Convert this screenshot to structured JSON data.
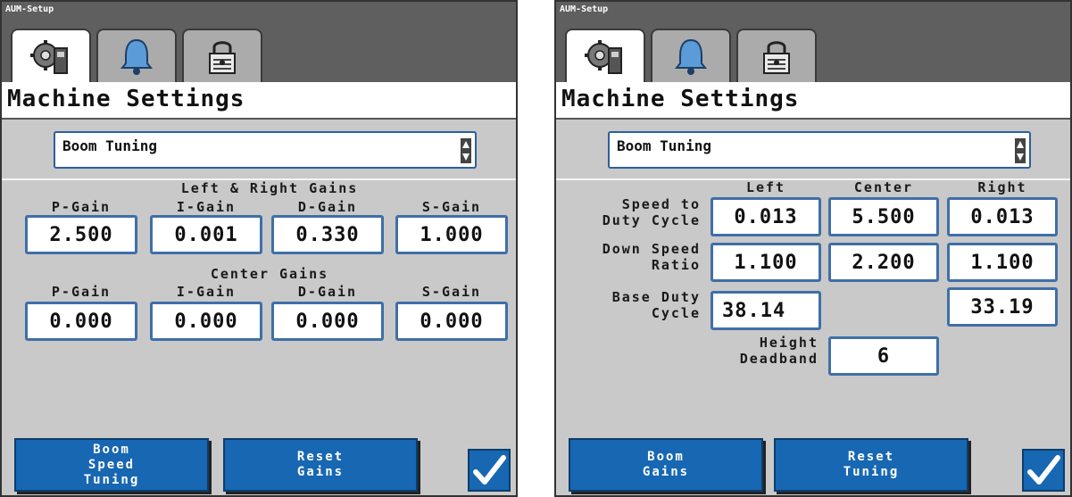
{
  "app_title": "AUM-Setup",
  "tabs": [
    {
      "icon": "machine-settings-icon",
      "active": true
    },
    {
      "icon": "bell-icon",
      "active": false
    },
    {
      "icon": "lock-icon",
      "active": false
    }
  ],
  "left_screen": {
    "page_title": "Machine Settings",
    "dropdown_value": "Boom Tuning",
    "lr_gains": {
      "heading": "Left & Right Gains",
      "p_label": "P-Gain",
      "i_label": "I-Gain",
      "d_label": "D-Gain",
      "s_label": "S-Gain",
      "p_value": "2.500",
      "i_value": "0.001",
      "d_value": "0.330",
      "s_value": "1.000"
    },
    "center_gains": {
      "heading": "Center Gains",
      "p_label": "P-Gain",
      "i_label": "I-Gain",
      "d_label": "D-Gain",
      "s_label": "S-Gain",
      "p_value": "0.000",
      "i_value": "0.000",
      "d_value": "0.000",
      "s_value": "0.000"
    },
    "buttons": {
      "boom_speed_tuning": "Boom\nSpeed\nTuning",
      "reset_gains": "Reset\nGains"
    }
  },
  "right_screen": {
    "page_title": "Machine Settings",
    "dropdown_value": "Boom Tuning",
    "columns": {
      "left": "Left",
      "center": "Center",
      "right": "Right"
    },
    "rows": {
      "speed_to_duty_cycle": {
        "label": "Speed to\nDuty Cycle",
        "left": "0.013",
        "center": "5.500",
        "right": "0.013"
      },
      "down_speed_ratio": {
        "label": "Down Speed\nRatio",
        "left": "1.100",
        "center": "2.200",
        "right": "1.100"
      },
      "base_duty_cycle": {
        "label": "Base Duty\nCycle",
        "left": "38.14",
        "right": "33.19"
      },
      "height_deadband": {
        "label": "Height\nDeadband",
        "value": "6"
      }
    },
    "buttons": {
      "boom_gains": "Boom\nGains",
      "reset_tuning": "Reset\nTuning"
    }
  }
}
